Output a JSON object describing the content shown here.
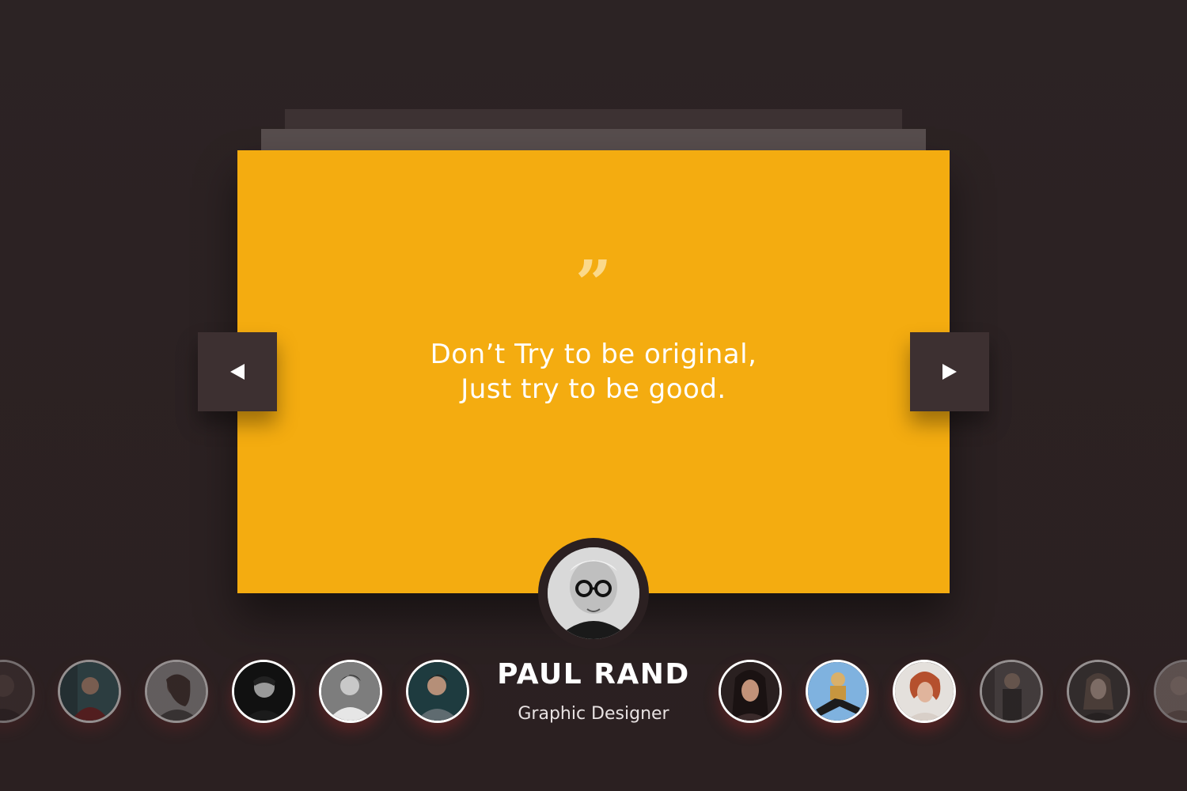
{
  "testimonial": {
    "quote_mark": "”",
    "quote_line_1": "Don’t Try to be original,",
    "quote_line_2": "Just try to be good.",
    "name": "PAUL RAND",
    "role": "Graphic Designer"
  },
  "navigation": {
    "prev_icon": "triangle-left-icon",
    "next_icon": "triangle-right-icon"
  },
  "colors": {
    "background": "#2b2021",
    "card": "#f4ac10",
    "nav_button": "#3d3031",
    "quote_mark": "#fbd98a",
    "text": "#ffffff"
  },
  "thumbnails": [
    {
      "id": "thumb-1",
      "state": "faded"
    },
    {
      "id": "thumb-2",
      "state": "faded"
    },
    {
      "id": "thumb-3",
      "state": "faded"
    },
    {
      "id": "thumb-4",
      "state": "normal"
    },
    {
      "id": "thumb-5",
      "state": "normal"
    },
    {
      "id": "thumb-6",
      "state": "normal"
    },
    {
      "id": "thumb-7",
      "state": "normal"
    },
    {
      "id": "thumb-8",
      "state": "normal"
    },
    {
      "id": "thumb-9",
      "state": "normal"
    },
    {
      "id": "thumb-10",
      "state": "faded"
    },
    {
      "id": "thumb-11",
      "state": "faded"
    },
    {
      "id": "thumb-12",
      "state": "faded"
    }
  ]
}
